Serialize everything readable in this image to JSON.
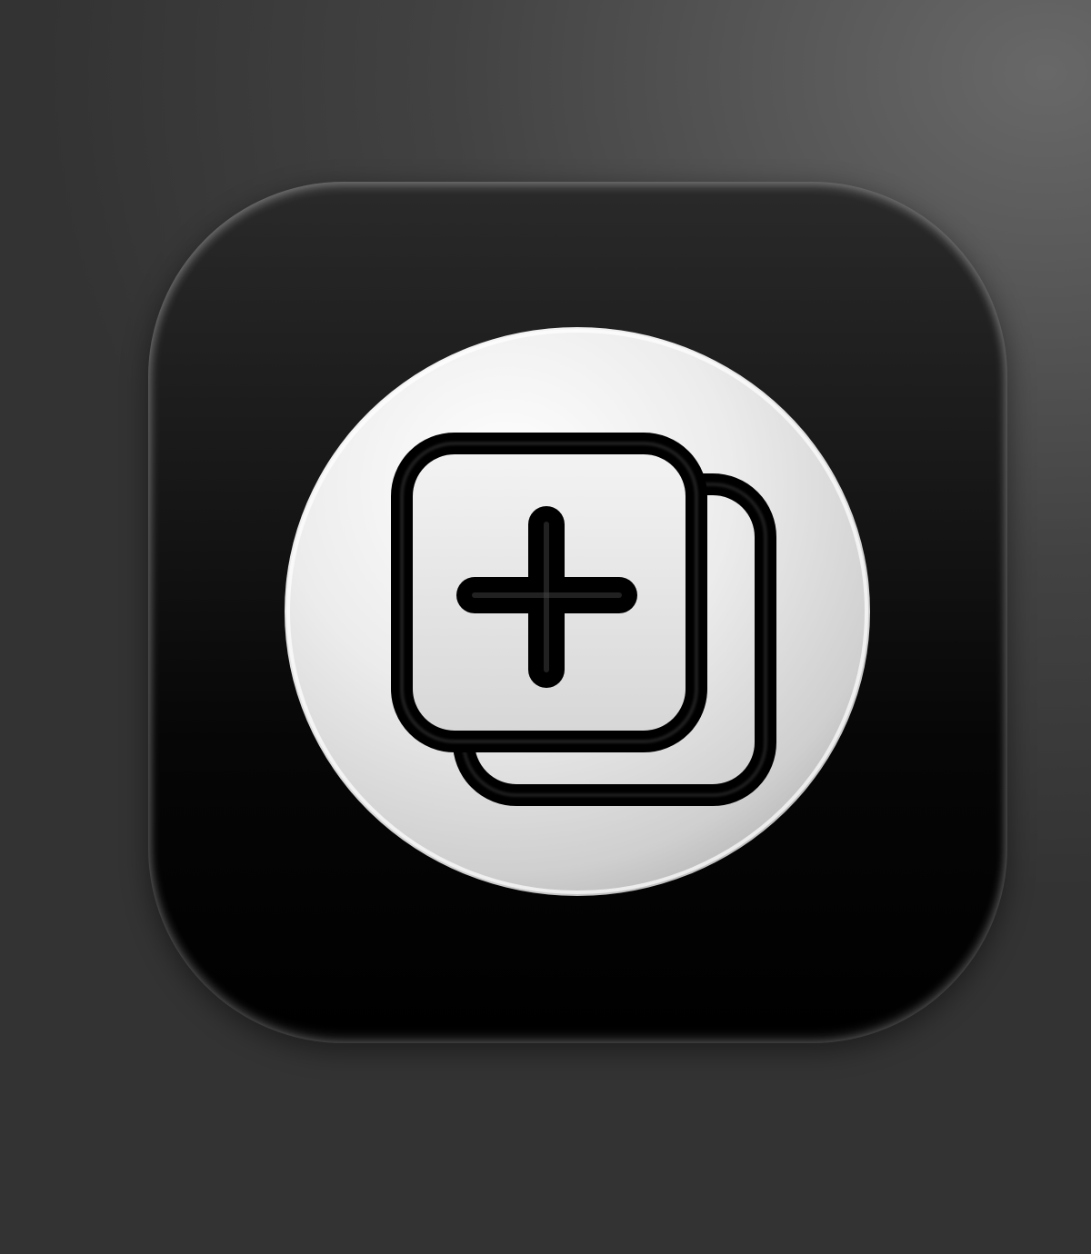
{
  "app_icon": {
    "icon_name": "duplicate-plus-icon",
    "colors": {
      "background_light": "#686868",
      "background_dark": "#333333",
      "tile_top": "#2a2a2a",
      "tile_bottom": "#000000",
      "badge_light": "#f2f2f2",
      "badge_shade": "#bdbdbd",
      "glyph_stroke": "#000000"
    }
  }
}
